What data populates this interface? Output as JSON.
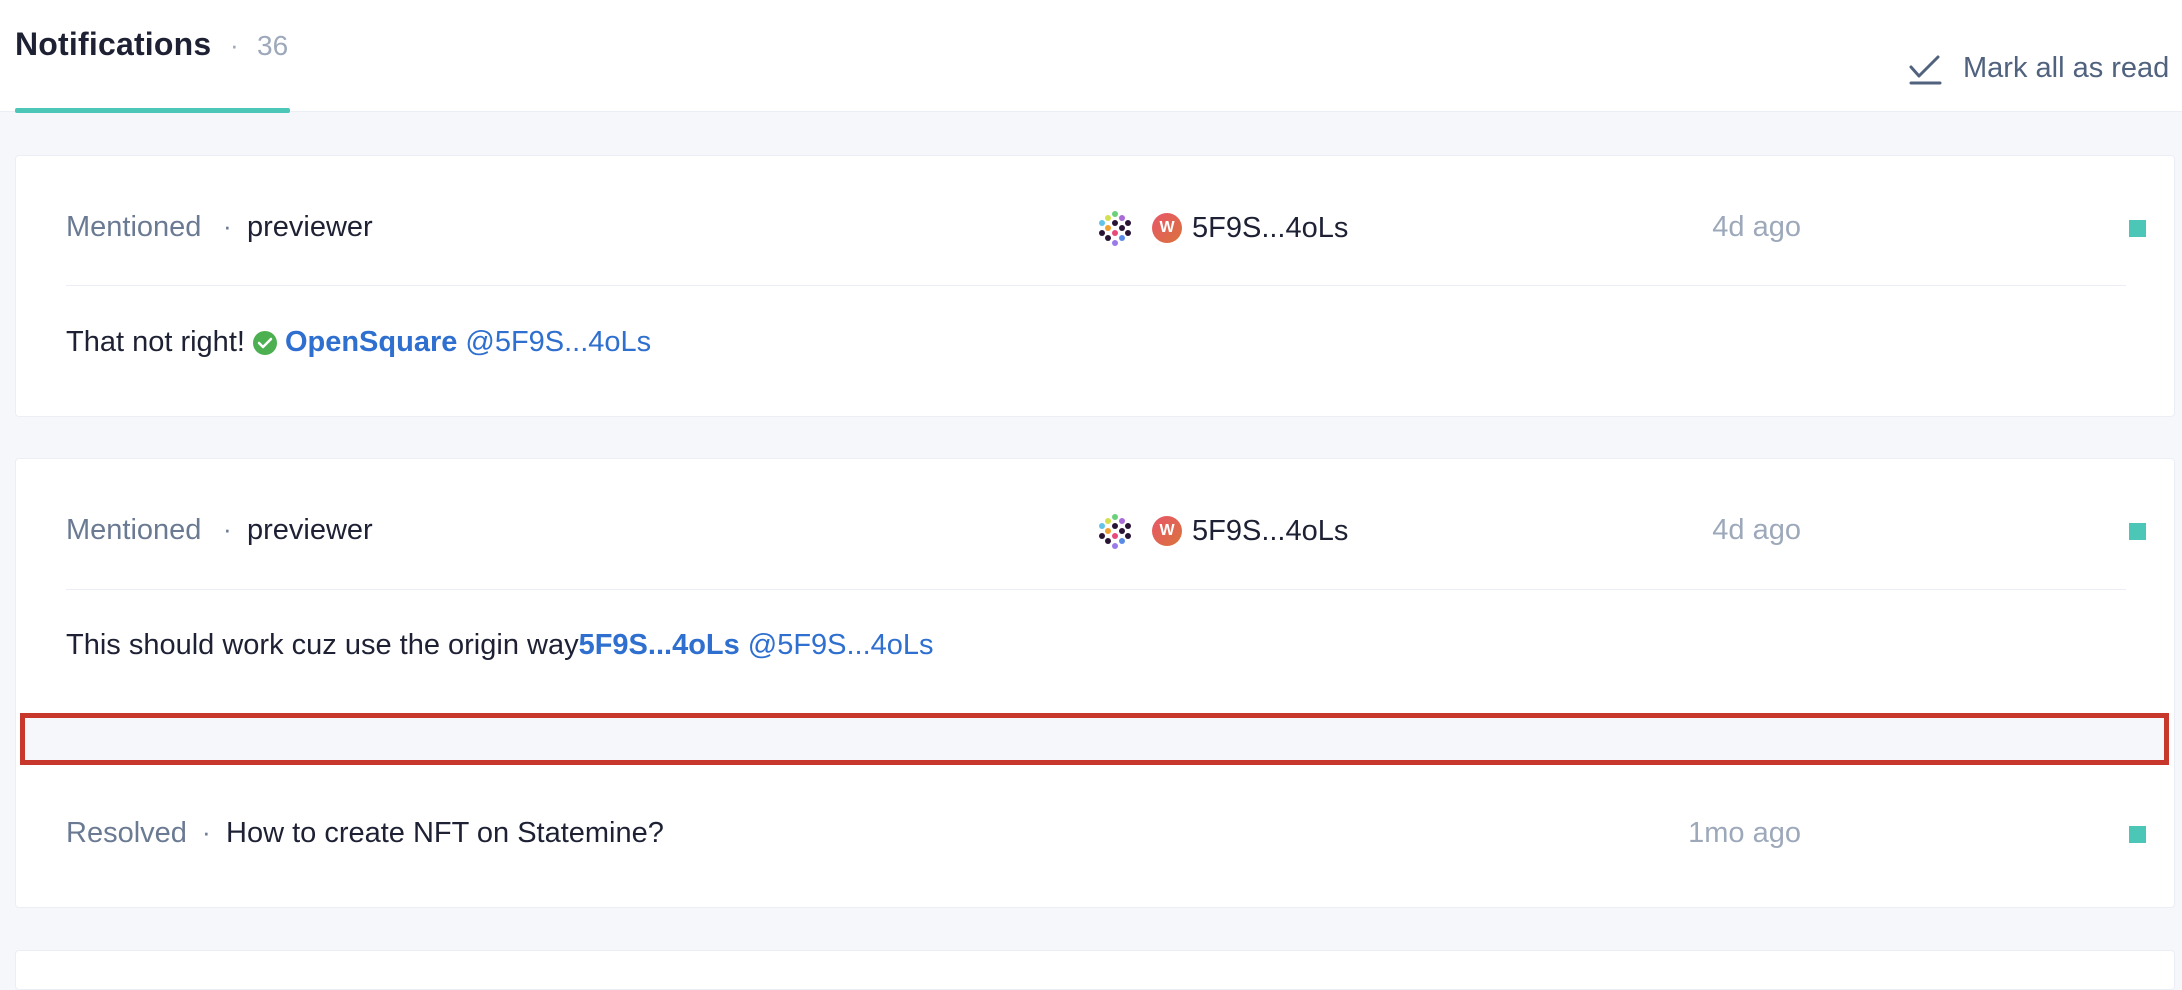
{
  "header": {
    "tab_title": "Notifications",
    "tab_dot": "·",
    "tab_count": "36",
    "mark_all_label": "Mark all as read"
  },
  "notifications": [
    {
      "kind": "Mentioned",
      "subject": "previewer",
      "author": "5F9S...4oLs",
      "time": "4d ago",
      "body_text": "That not right!",
      "link_name": "OpenSquare",
      "link_handle": "@5F9S...4oLs"
    },
    {
      "kind": "Mentioned",
      "subject": "previewer",
      "author": "5F9S...4oLs",
      "time": "4d ago",
      "body_text": "This should work cuz use the origin way",
      "link_name": "5F9S...4oLs",
      "link_handle": "@5F9S...4oLs"
    },
    {
      "kind": "Resolved",
      "subject": "How to create NFT on Statemine?",
      "time": "1mo ago"
    }
  ],
  "sep": "·",
  "badge_letter": "W",
  "colors": {
    "accent": "#4cc6b6",
    "link": "#2e6fcf",
    "highlight": "#c8372b",
    "verified": "#4caf50"
  },
  "icons": {
    "mark_all": "check-all-icon",
    "avatar": "hex-avatar-icon",
    "badge": "w-badge-icon",
    "verified": "verified-check-icon",
    "unread": "unread-dot-icon"
  }
}
